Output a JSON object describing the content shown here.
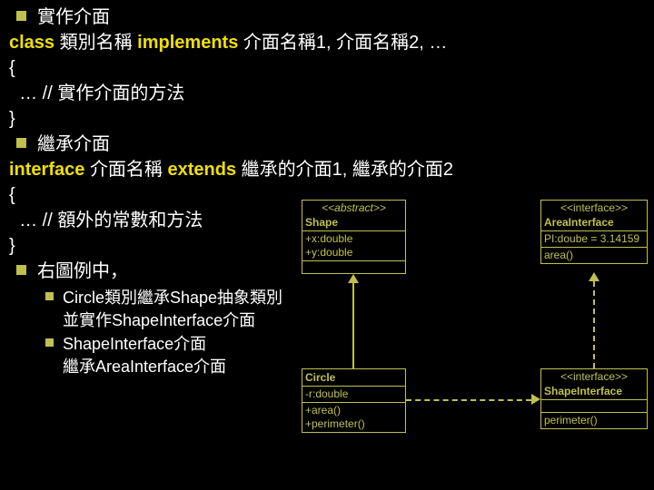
{
  "bullets": {
    "b1": "實作介面",
    "b2": "繼承介面",
    "b3": "右圖例中，"
  },
  "code": {
    "l1a": "class ",
    "l1b": "類別名稱 ",
    "l1c": "implements ",
    "l1d": "介面名稱1, 介面名稱2, …",
    "l2": "{",
    "l3": "  … // 實作介面的方法",
    "l4": "}",
    "l5a": "interface ",
    "l5b": "介面名稱 ",
    "l5c": "extends ",
    "l5d": "繼承的介面1, 繼承的介面2",
    "l6": "{",
    "l7": "  … // 額外的常數和方法",
    "l8": "}"
  },
  "sub": {
    "s1a": "Circle類別繼承Shape抽象類別",
    "s1b": "並實作ShapeInterface介面",
    "s2a": "ShapeInterface介面",
    "s2b": "繼承AreaInterface介面"
  },
  "uml": {
    "shape": {
      "stereo": "<<abstract>>",
      "name": "Shape",
      "a1": "+x:double",
      "a2": "+y:double"
    },
    "area": {
      "stereo": "<<interface>>",
      "name": "AreaInterface",
      "c1": "PI:doube = 3.14159",
      "m1": "area()"
    },
    "circle": {
      "name": "Circle",
      "a1": "-r:double",
      "m1": "+area()",
      "m2": "+perimeter()"
    },
    "si": {
      "stereo": "<<interface>>",
      "name": "ShapeInterface",
      "m1": "perimeter()"
    }
  }
}
